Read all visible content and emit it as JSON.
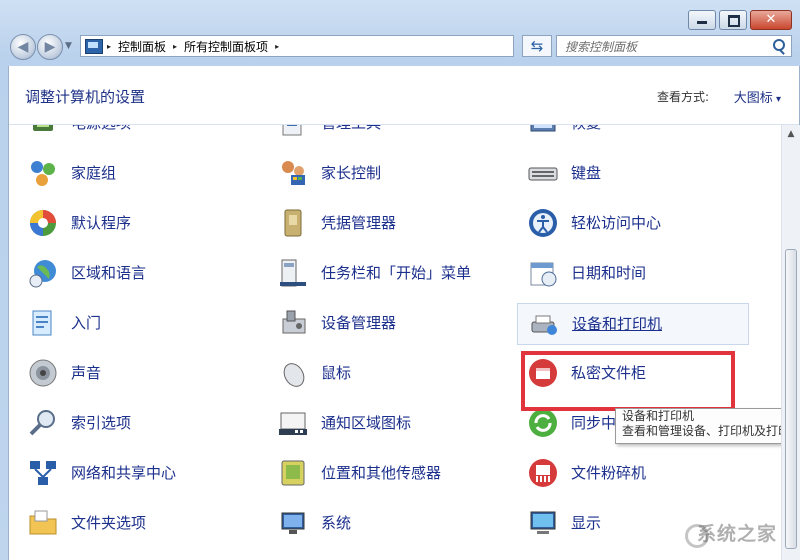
{
  "window": {
    "caption_buttons": {
      "close_glyph": "✕"
    }
  },
  "address": {
    "crumbs": [
      "控制面板",
      "所有控制面板项"
    ],
    "separator": "▸"
  },
  "search": {
    "placeholder": "搜索控制面板"
  },
  "header": {
    "title": "调整计算机的设置",
    "view_by_label": "查看方式:",
    "view_by_value": "大图标"
  },
  "items": [
    {
      "label": "电源选项",
      "icon": "power-options-icon"
    },
    {
      "label": "管理工具",
      "icon": "admin-tools-icon"
    },
    {
      "label": "恢复",
      "icon": "recovery-icon"
    },
    {
      "label": "家庭组",
      "icon": "homegroup-icon"
    },
    {
      "label": "家长控制",
      "icon": "parental-controls-icon"
    },
    {
      "label": "键盘",
      "icon": "keyboard-icon"
    },
    {
      "label": "默认程序",
      "icon": "default-programs-icon"
    },
    {
      "label": "凭据管理器",
      "icon": "credential-manager-icon"
    },
    {
      "label": "轻松访问中心",
      "icon": "ease-of-access-icon"
    },
    {
      "label": "区域和语言",
      "icon": "region-language-icon"
    },
    {
      "label": "任务栏和「开始」菜单",
      "icon": "taskbar-icon"
    },
    {
      "label": "日期和时间",
      "icon": "date-time-icon"
    },
    {
      "label": "入门",
      "icon": "getting-started-icon"
    },
    {
      "label": "设备管理器",
      "icon": "device-manager-icon"
    },
    {
      "label": "设备和打印机",
      "icon": "devices-printers-icon",
      "selected": true
    },
    {
      "label": "声音",
      "icon": "sound-icon"
    },
    {
      "label": "鼠标",
      "icon": "mouse-icon"
    },
    {
      "label": "私密文件柜",
      "icon": "private-locker-icon"
    },
    {
      "label": "索引选项",
      "icon": "indexing-icon"
    },
    {
      "label": "通知区域图标",
      "icon": "notification-area-icon"
    },
    {
      "label": "同步中心",
      "icon": "sync-center-icon"
    },
    {
      "label": "网络和共享中心",
      "icon": "network-sharing-icon"
    },
    {
      "label": "位置和其他传感器",
      "icon": "location-sensors-icon"
    },
    {
      "label": "文件粉碎机",
      "icon": "file-shredder-icon"
    },
    {
      "label": "文件夹选项",
      "icon": "folder-options-icon"
    },
    {
      "label": "系统",
      "icon": "system-icon"
    },
    {
      "label": "显示",
      "icon": "display-icon"
    }
  ],
  "tooltip": {
    "title": "设备和打印机",
    "text": "查看和管理设备、打印机及打印作业"
  },
  "watermark": {
    "text": "系统之家"
  },
  "colors": {
    "link": "#1b2f8c",
    "highlight": "#e2343d"
  }
}
